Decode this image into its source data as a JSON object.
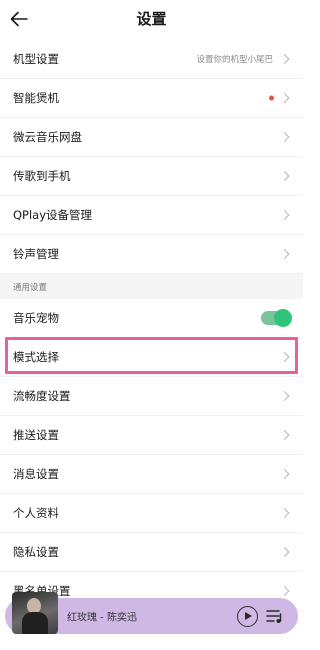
{
  "header": {
    "title": "设置",
    "back_icon": "arrow-left-icon"
  },
  "list": {
    "items": [
      {
        "label": "机型设置",
        "hint": "设置你的机型小尾巴"
      },
      {
        "label": "智能煲机",
        "badge": "red-dot"
      },
      {
        "label": "微云音乐网盘"
      },
      {
        "label": "传歌到手机"
      },
      {
        "label": "QPlay设备管理"
      },
      {
        "label": "铃声管理"
      }
    ],
    "section_title": "通用设置",
    "general_items": [
      {
        "label": "音乐宠物",
        "toggle": true
      },
      {
        "label": "模式选择"
      },
      {
        "label": "流畅度设置"
      },
      {
        "label": "推送设置"
      },
      {
        "label": "消息设置"
      },
      {
        "label": "个人资料"
      },
      {
        "label": "隐私设置"
      },
      {
        "label": "黑名单设置"
      }
    ]
  },
  "player": {
    "song": "红玫瑰 - 陈奕迅",
    "play_icon": "play-circle-icon",
    "queue_icon": "playlist-icon"
  },
  "colors": {
    "accent_green": "#31c27c",
    "highlight_pink": "#e8609a",
    "player_bg": "#cfb9e4",
    "badge_red": "#f04b4b"
  }
}
